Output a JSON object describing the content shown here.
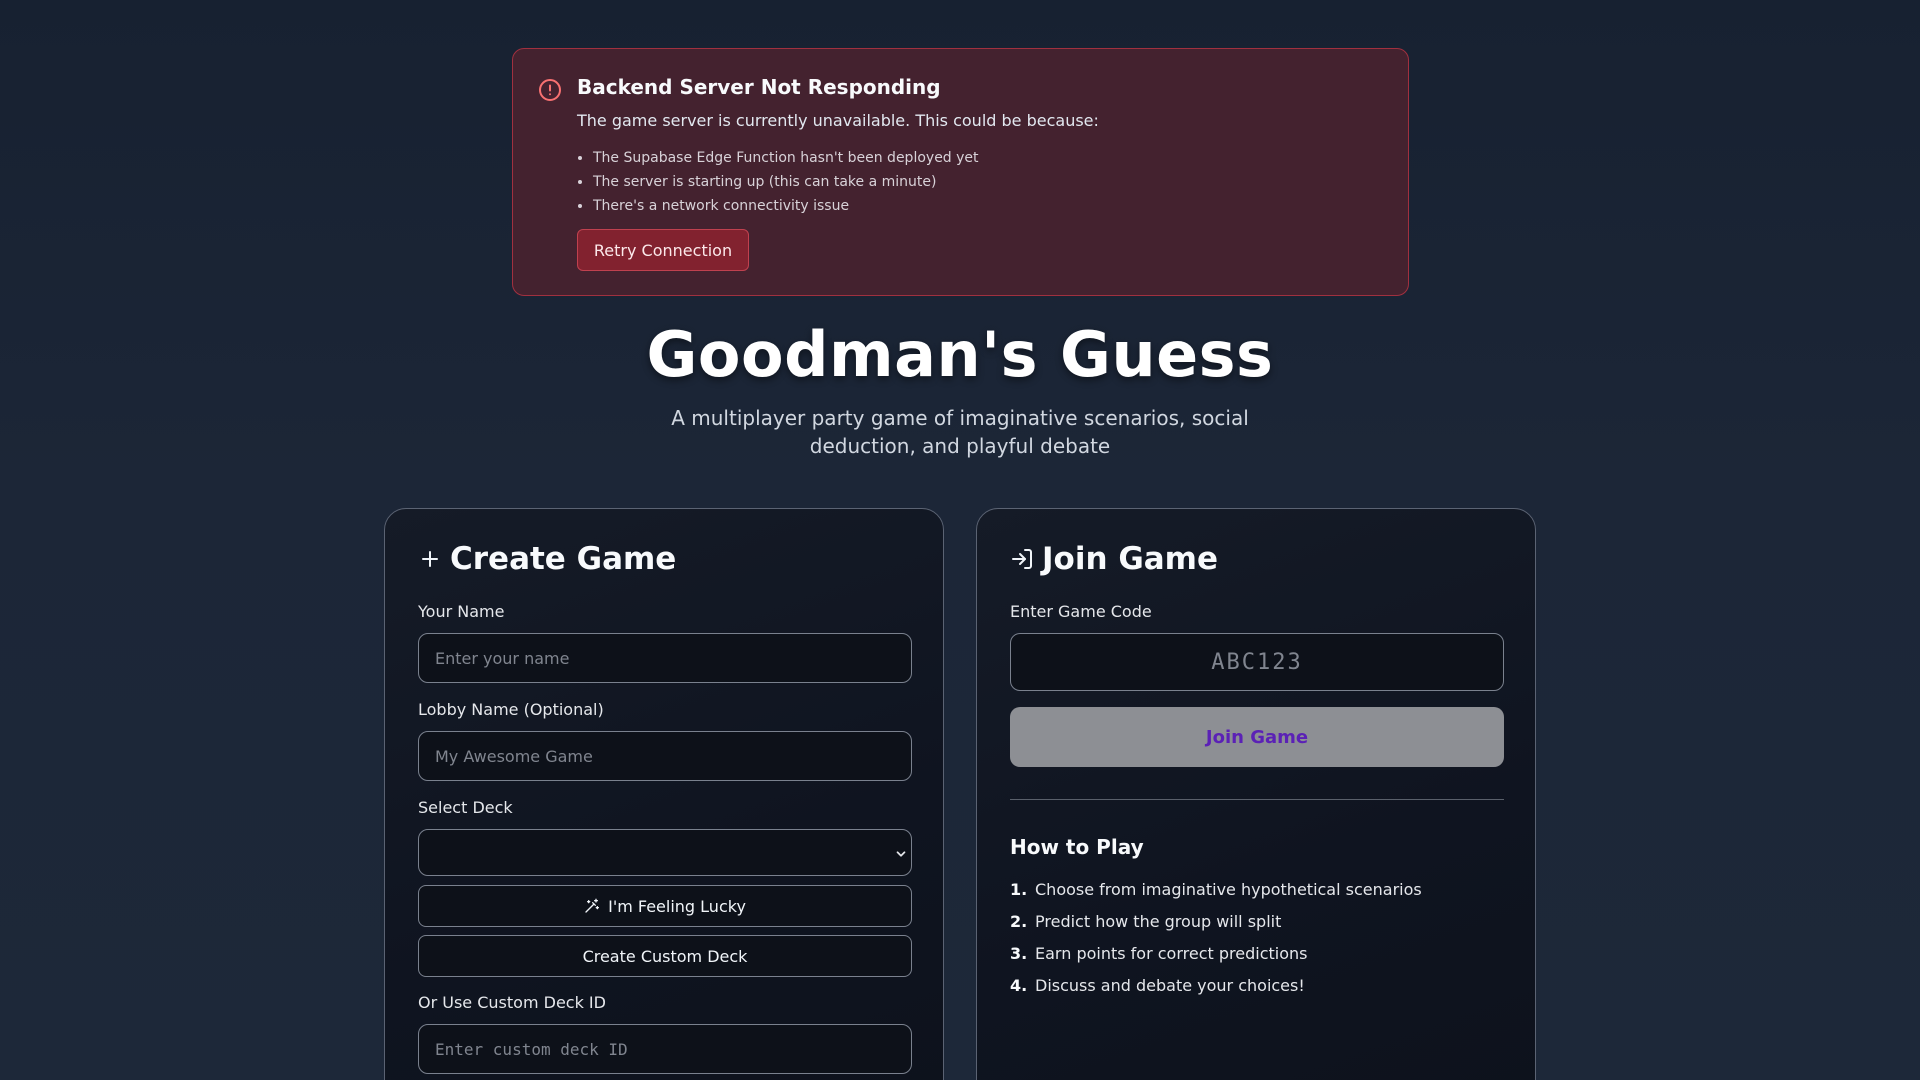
{
  "alert": {
    "icon": "alert-circle-icon",
    "title": "Backend Server Not Responding",
    "description": "The game server is currently unavailable. This could be because:",
    "reasons": [
      "The Supabase Edge Function hasn't been deployed yet",
      "The server is starting up (this can take a minute)",
      "There's a network connectivity issue"
    ],
    "retry_label": "Retry Connection",
    "accent_color": "#f87171"
  },
  "hero": {
    "title": "Goodman's Guess",
    "subtitle": "A multiplayer party game of imaginative scenarios, social deduction, and playful debate"
  },
  "create": {
    "icon": "plus-icon",
    "title": "Create Game",
    "name_label": "Your Name",
    "name_placeholder": "Enter your name",
    "lobby_label": "Lobby Name (Optional)",
    "lobby_placeholder": "My Awesome Game",
    "deck_label": "Select Deck",
    "deck_value": "",
    "lucky_icon": "magic-wand-icon",
    "lucky_label": "I'm Feeling Lucky",
    "custom_deck_label": "Create Custom Deck",
    "custom_id_label": "Or Use Custom Deck ID",
    "custom_id_placeholder": "Enter custom deck ID"
  },
  "join": {
    "icon": "log-in-icon",
    "title": "Join Game",
    "code_label": "Enter Game Code",
    "code_placeholder": "ABC123",
    "join_label": "Join Game",
    "howto_title": "How to Play",
    "steps": [
      {
        "num": "1.",
        "text": "Choose from imaginative hypothetical scenarios"
      },
      {
        "num": "2.",
        "text": "Predict how the group will split"
      },
      {
        "num": "3.",
        "text": "Earn points for correct predictions"
      },
      {
        "num": "4.",
        "text": "Discuss and debate your choices!"
      }
    ]
  }
}
